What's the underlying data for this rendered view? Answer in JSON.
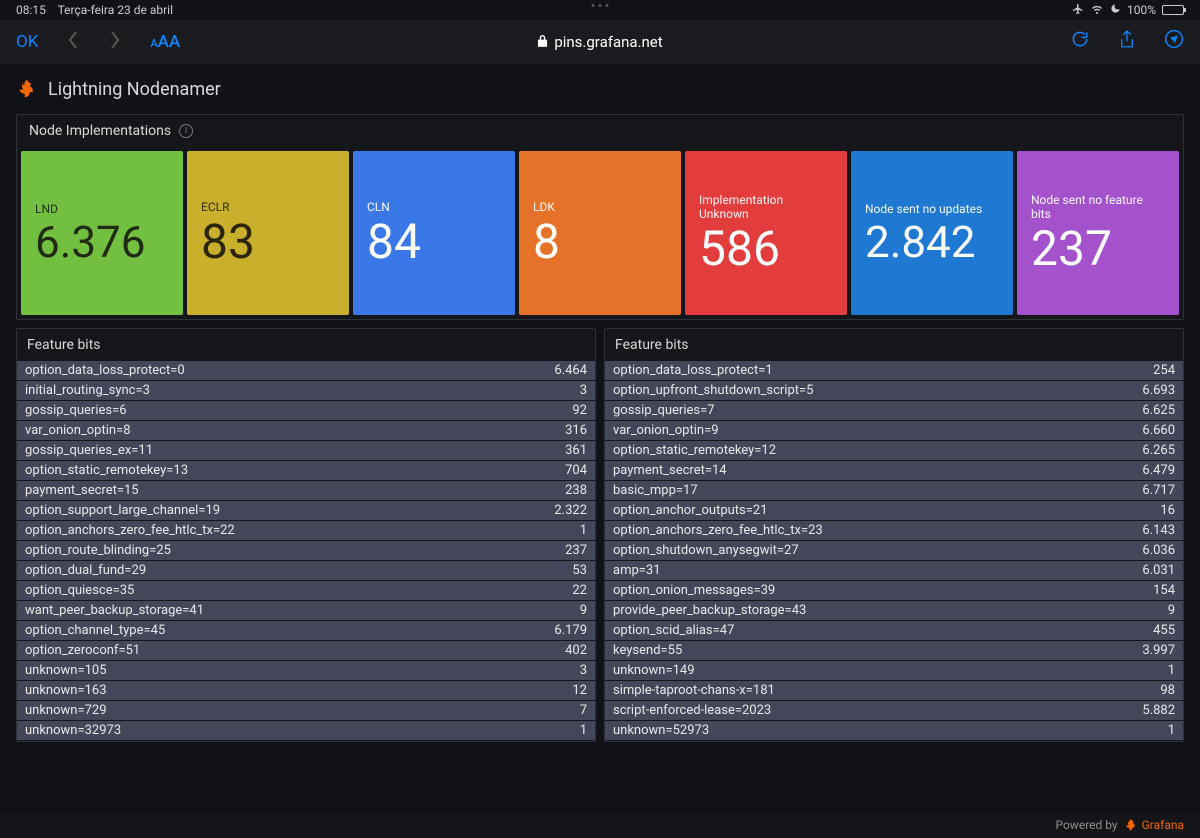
{
  "status": {
    "time": "08:15",
    "date": "Terça-feira 23 de abril",
    "battery_pct": "100%"
  },
  "nav": {
    "ok": "OK",
    "aa": "AA",
    "small_a": "A",
    "url": "pins.grafana.net"
  },
  "dashboard": {
    "title": "Lightning Nodenamer"
  },
  "row": {
    "title": "Node Implementations"
  },
  "stats": [
    {
      "label": "LND",
      "value": "6.376",
      "bg": "#73bf40",
      "fg": "#1f2b12"
    },
    {
      "label": "ECLR",
      "value": "83",
      "bg": "#c8b02d",
      "fg": "#2d2606"
    },
    {
      "label": "CLN",
      "value": "84",
      "bg": "#3a78e7",
      "fg": "#ffffff"
    },
    {
      "label": "LDK",
      "value": "8",
      "bg": "#e6722a",
      "fg": "#ffffff"
    },
    {
      "label": "Implementation Unknown",
      "value": "586",
      "bg": "#e23c3c",
      "fg": "#ffffff"
    },
    {
      "label": "Node sent no updates",
      "value": "2.842",
      "bg": "#1f78d1",
      "fg": "#ffffff"
    },
    {
      "label": "Node sent no feature bits",
      "value": "237",
      "bg": "#a352cc",
      "fg": "#ffffff"
    }
  ],
  "tables": [
    {
      "title": "Feature bits",
      "rows": [
        {
          "k": "option_data_loss_protect=0",
          "v": "6.464"
        },
        {
          "k": "initial_routing_sync=3",
          "v": "3"
        },
        {
          "k": "gossip_queries=6",
          "v": "92"
        },
        {
          "k": "var_onion_optin=8",
          "v": "316"
        },
        {
          "k": "gossip_queries_ex=11",
          "v": "361"
        },
        {
          "k": "option_static_remotekey=13",
          "v": "704"
        },
        {
          "k": "payment_secret=15",
          "v": "238"
        },
        {
          "k": "option_support_large_channel=19",
          "v": "2.322"
        },
        {
          "k": "option_anchors_zero_fee_htlc_tx=22",
          "v": "1"
        },
        {
          "k": "option_route_blinding=25",
          "v": "237"
        },
        {
          "k": "option_dual_fund=29",
          "v": "53"
        },
        {
          "k": "option_quiesce=35",
          "v": "22"
        },
        {
          "k": "want_peer_backup_storage=41",
          "v": "9"
        },
        {
          "k": "option_channel_type=45",
          "v": "6.179"
        },
        {
          "k": "option_zeroconf=51",
          "v": "402"
        },
        {
          "k": "unknown=105",
          "v": "3"
        },
        {
          "k": "unknown=163",
          "v": "12"
        },
        {
          "k": "unknown=729",
          "v": "7"
        },
        {
          "k": "unknown=32973",
          "v": "1"
        }
      ]
    },
    {
      "title": "Feature bits",
      "rows": [
        {
          "k": "option_data_loss_protect=1",
          "v": "254"
        },
        {
          "k": "option_upfront_shutdown_script=5",
          "v": "6.693"
        },
        {
          "k": "gossip_queries=7",
          "v": "6.625"
        },
        {
          "k": "var_onion_optin=9",
          "v": "6.660"
        },
        {
          "k": "option_static_remotekey=12",
          "v": "6.265"
        },
        {
          "k": "payment_secret=14",
          "v": "6.479"
        },
        {
          "k": "basic_mpp=17",
          "v": "6.717"
        },
        {
          "k": "option_anchor_outputs=21",
          "v": "16"
        },
        {
          "k": "option_anchors_zero_fee_htlc_tx=23",
          "v": "6.143"
        },
        {
          "k": "option_shutdown_anysegwit=27",
          "v": "6.036"
        },
        {
          "k": "amp=31",
          "v": "6.031"
        },
        {
          "k": "option_onion_messages=39",
          "v": "154"
        },
        {
          "k": "provide_peer_backup_storage=43",
          "v": "9"
        },
        {
          "k": "option_scid_alias=47",
          "v": "455"
        },
        {
          "k": "keysend=55",
          "v": "3.997"
        },
        {
          "k": "unknown=149",
          "v": "1"
        },
        {
          "k": "simple-taproot-chans-x=181",
          "v": "98"
        },
        {
          "k": "script-enforced-lease=2023",
          "v": "5.882"
        },
        {
          "k": "unknown=52973",
          "v": "1"
        }
      ]
    }
  ],
  "footer": {
    "powered": "Powered by",
    "brand": "Grafana"
  }
}
